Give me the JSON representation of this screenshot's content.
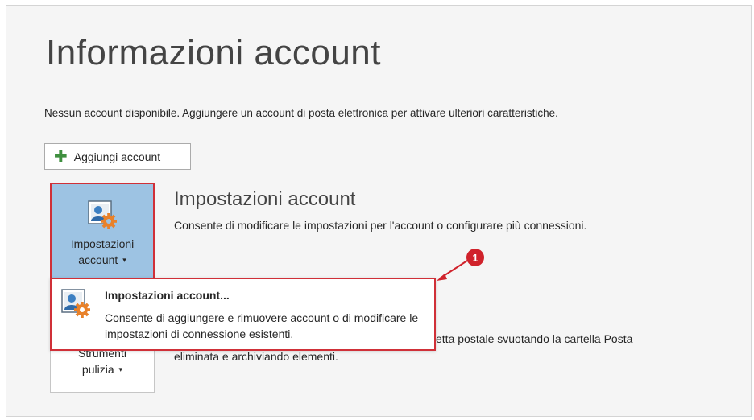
{
  "page": {
    "title": "Informazioni account",
    "intro": "Nessun account disponibile. Aggiungere un account di posta elettronica per attivare ulteriori caratteristiche."
  },
  "add_account": {
    "label": "Aggiungi account",
    "icon": "plus-icon"
  },
  "account_settings": {
    "tile_label_line1": "Impostazioni",
    "tile_label_line2": "account",
    "caret": "▾",
    "title": "Impostazioni account",
    "description": "Consente di modificare le impostazioni per l'account o configurare più connessioni.",
    "icon": "account-settings-icon"
  },
  "dropdown": {
    "item_title": "Impostazioni account...",
    "item_description": "Consente di aggiungere e rimuovere account o di modificare le impostazioni di connessione esistenti.",
    "icon": "account-settings-icon"
  },
  "cleanup": {
    "tile_label_line1": "Strumenti",
    "tile_label_line2": "pulizia",
    "caret": "▾",
    "description_visible_part1": "etta postale svuotando la cartella Posta",
    "description_visible_part2": "eliminata e archiviando elementi."
  },
  "annotation": {
    "badge": "1"
  },
  "colors": {
    "highlight_border": "#d03038",
    "tile_selected_bg": "#9dc3e3",
    "badge": "#d0222b",
    "plus": "#3f8f3f"
  }
}
